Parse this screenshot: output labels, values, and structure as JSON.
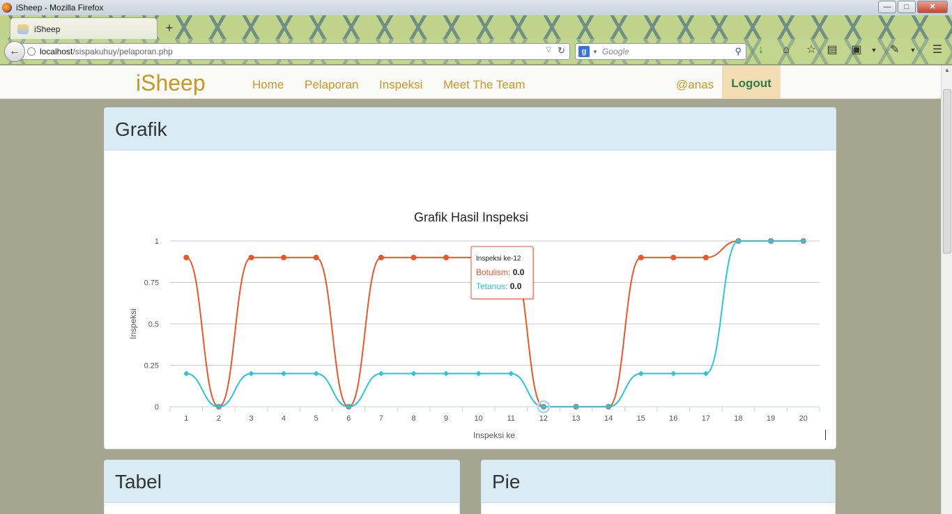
{
  "window": {
    "title": "iSheep - Mozilla Firefox"
  },
  "browser": {
    "tab_title": "iSheep",
    "url_host": "localhost",
    "url_path": "/sispakuhuy/pelaporan.php",
    "search_placeholder": "Google",
    "search_engine_letter": "g"
  },
  "site": {
    "brand": "iSheep",
    "nav": [
      {
        "label": "Home"
      },
      {
        "label": "Pelaporan"
      },
      {
        "label": "Inspeksi"
      },
      {
        "label": "Meet The Team"
      }
    ],
    "user": "@anas",
    "logout": "Logout"
  },
  "panels": {
    "grafik": "Grafik",
    "tabel": "Tabel",
    "pie": "Pie"
  },
  "chart_data": {
    "type": "line",
    "title": "Grafik Hasil Inspeksi",
    "xlabel": "Inspeksi ke",
    "ylabel": "Inspeksi",
    "categories": [
      "1",
      "2",
      "3",
      "4",
      "5",
      "6",
      "7",
      "8",
      "9",
      "10",
      "11",
      "12",
      "13",
      "14",
      "15",
      "16",
      "17",
      "18",
      "19",
      "20"
    ],
    "ylim": [
      0,
      1
    ],
    "yticks": [
      "0",
      "0.25",
      "0.5",
      "0.75",
      "1"
    ],
    "grid": true,
    "legend": "bottom-center",
    "series": [
      {
        "name": "Botulism",
        "color": "#e8572a",
        "values": [
          0.9,
          0,
          0.9,
          0.9,
          0.9,
          0,
          0.9,
          0.9,
          0.9,
          0.9,
          0.9,
          0,
          0,
          0,
          0.9,
          0.9,
          0.9,
          1,
          1,
          1
        ]
      },
      {
        "name": "Tetanus",
        "color": "#2bc4d9",
        "values": [
          0.2,
          0,
          0.2,
          0.2,
          0.2,
          0,
          0.2,
          0.2,
          0.2,
          0.2,
          0.2,
          0,
          0,
          0,
          0.2,
          0.2,
          0.2,
          1,
          1,
          1
        ]
      }
    ],
    "tooltip": {
      "header": "Inspeksi ke-12",
      "rows": [
        {
          "label": "Botulism:",
          "value": "0.0"
        },
        {
          "label": "Tetanus:",
          "value": "0.0"
        }
      ]
    }
  }
}
